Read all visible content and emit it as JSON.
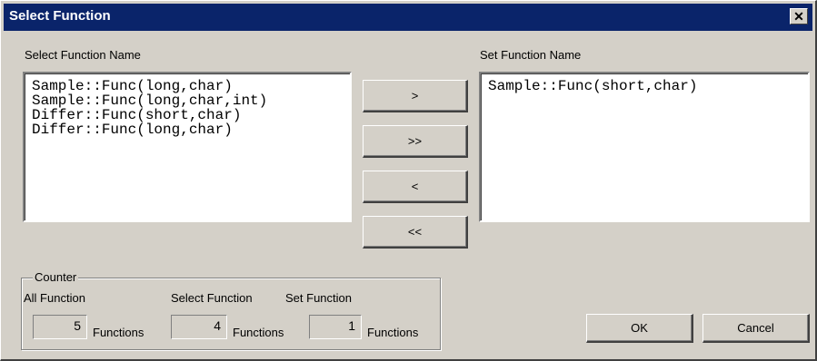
{
  "window": {
    "title": "Select Function",
    "close_glyph": "✕"
  },
  "select_panel": {
    "label": "Select Function Name",
    "items": [
      "Sample::Func(long,char)",
      "Sample::Func(long,char,int)",
      "Differ::Func(short,char)",
      "Differ::Func(long,char)"
    ]
  },
  "set_panel": {
    "label": "Set Function Name",
    "items": [
      "Sample::Func(short,char)"
    ]
  },
  "transfer_buttons": {
    "add": ">",
    "add_all": ">>",
    "remove": "<",
    "remove_all": "<<"
  },
  "counter": {
    "legend": "Counter",
    "all_label": "All Function",
    "select_label": "Select Function",
    "set_label": "Set Function",
    "all_value": "5",
    "select_value": "4",
    "set_value": "1",
    "unit": "Functions"
  },
  "footer": {
    "ok": "OK",
    "cancel": "Cancel"
  },
  "colors": {
    "titlebar": "#0a246a",
    "face": "#d4d0c8"
  }
}
